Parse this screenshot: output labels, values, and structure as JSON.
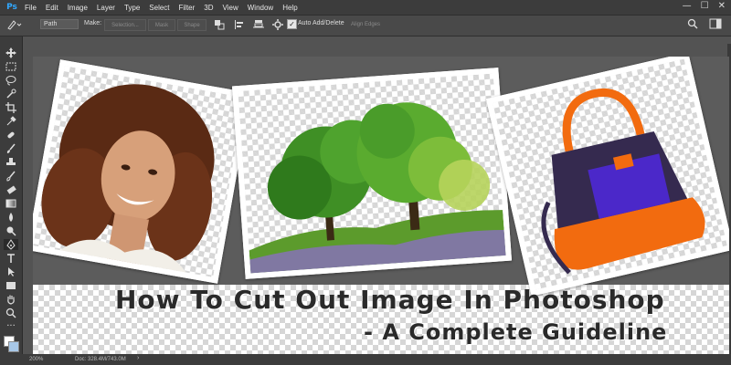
{
  "app": {
    "logo": "Ps"
  },
  "menu": [
    "File",
    "Edit",
    "Image",
    "Layer",
    "Type",
    "Select",
    "Filter",
    "3D",
    "View",
    "Window",
    "Help"
  ],
  "window_controls": {
    "minimize": "—",
    "maximize": "☐",
    "close": "✕"
  },
  "options_bar": {
    "tool_mode": "Path",
    "make_label": "Make:",
    "selection_button": "Selection...",
    "mask_button": "Mask",
    "shape_button": "Shape",
    "auto_add_delete": "Auto Add/Delete",
    "auto_add_delete_checked": true,
    "align_edges": "Align Edges"
  },
  "status": {
    "zoom": "200%",
    "doc_info": "Doc: 328.4M/743.0M"
  },
  "banner": {
    "title_line1": "How To Cut Out Image In Photoshop",
    "title_line2": "- A Complete Guideline"
  },
  "colors": {
    "panel": "#3c3c3c",
    "canvas": "#535353",
    "accent": "#31a8ff"
  },
  "icons": [
    "move-icon",
    "marquee-icon",
    "lasso-icon",
    "quick-select-icon",
    "crop-icon",
    "eyedropper-icon",
    "healing-icon",
    "brush-icon",
    "stamp-icon",
    "history-brush-icon",
    "eraser-icon",
    "gradient-icon",
    "blur-icon",
    "dodge-icon",
    "pen-icon",
    "type-icon",
    "path-select-icon",
    "rectangle-icon",
    "hand-icon",
    "zoom-icon"
  ]
}
